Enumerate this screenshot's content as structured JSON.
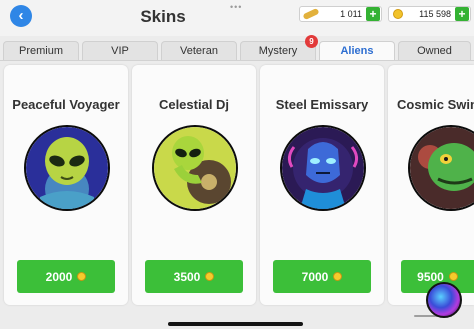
{
  "header": {
    "title": "Skins",
    "back_icon": "chevron-left-icon",
    "currencies": [
      {
        "icon": "bone-icon",
        "value": "1 011",
        "plus": "+"
      },
      {
        "icon": "coin-icon",
        "value": "115 598",
        "plus": "+"
      }
    ]
  },
  "tabs": [
    {
      "label": "Premium",
      "active": false
    },
    {
      "label": "VIP",
      "active": false
    },
    {
      "label": "Veteran",
      "active": false
    },
    {
      "label": "Mystery",
      "active": false,
      "badge": "9"
    },
    {
      "label": "Aliens",
      "active": true
    },
    {
      "label": "Owned",
      "active": false
    }
  ],
  "skins": [
    {
      "name": "Peaceful Voyager",
      "price": "2000"
    },
    {
      "name": "Celestial Dj",
      "price": "3500"
    },
    {
      "name": "Steel Emissary",
      "price": "7000"
    },
    {
      "name": "Cosmic Swin",
      "price": "9500"
    }
  ],
  "colors": {
    "accent": "#2f86e6",
    "buy_green": "#3cbf39",
    "active_tab": "#2d6ed1",
    "badge_red": "#e23a3a"
  }
}
